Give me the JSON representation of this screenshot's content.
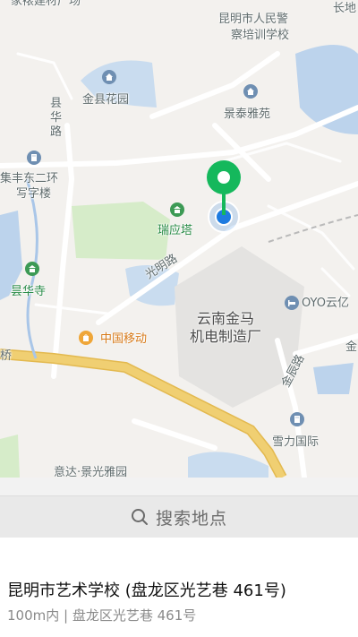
{
  "map": {
    "labels": {
      "top_cut": "家裱建材厂场",
      "changdi": "长地",
      "police_school_line1": "昆明市人民警",
      "police_school_line2": "察培训学校",
      "jinxian_garden": "金县花园",
      "xianhua_road": "县华路",
      "jingtai_yayuan": "景泰雅苑",
      "jifeng_line1": "集丰东二环",
      "jifeng_line2": "写字楼",
      "ruiying_tower": "瑞应塔",
      "xianhua_temple": "昙华寺",
      "guangming_road": "光明路",
      "oyo": "OYO云亿",
      "yunnan_jinma_line1": "云南金马",
      "yunnan_jinma_line2": "机电制造厂",
      "china_mobile": "中国移动",
      "qiao": "桥",
      "jinxing_road": "金辰路",
      "xueli_intl": "雪力国际",
      "yida_garden": "意达·景光雅园",
      "jin_cut": "金"
    }
  },
  "search": {
    "placeholder": "搜索地点"
  },
  "result": {
    "title": "昆明市艺术学校 (盘龙区光艺巷 461号)",
    "subtitle": "100m内 | 盘龙区光艺巷 461号"
  },
  "colors": {
    "pin_green": "#15b85c",
    "location_blue": "#1e7be0",
    "highway_yellow": "#f0cf72",
    "water": "#bcd3ec",
    "park": "#d6ecc9"
  }
}
